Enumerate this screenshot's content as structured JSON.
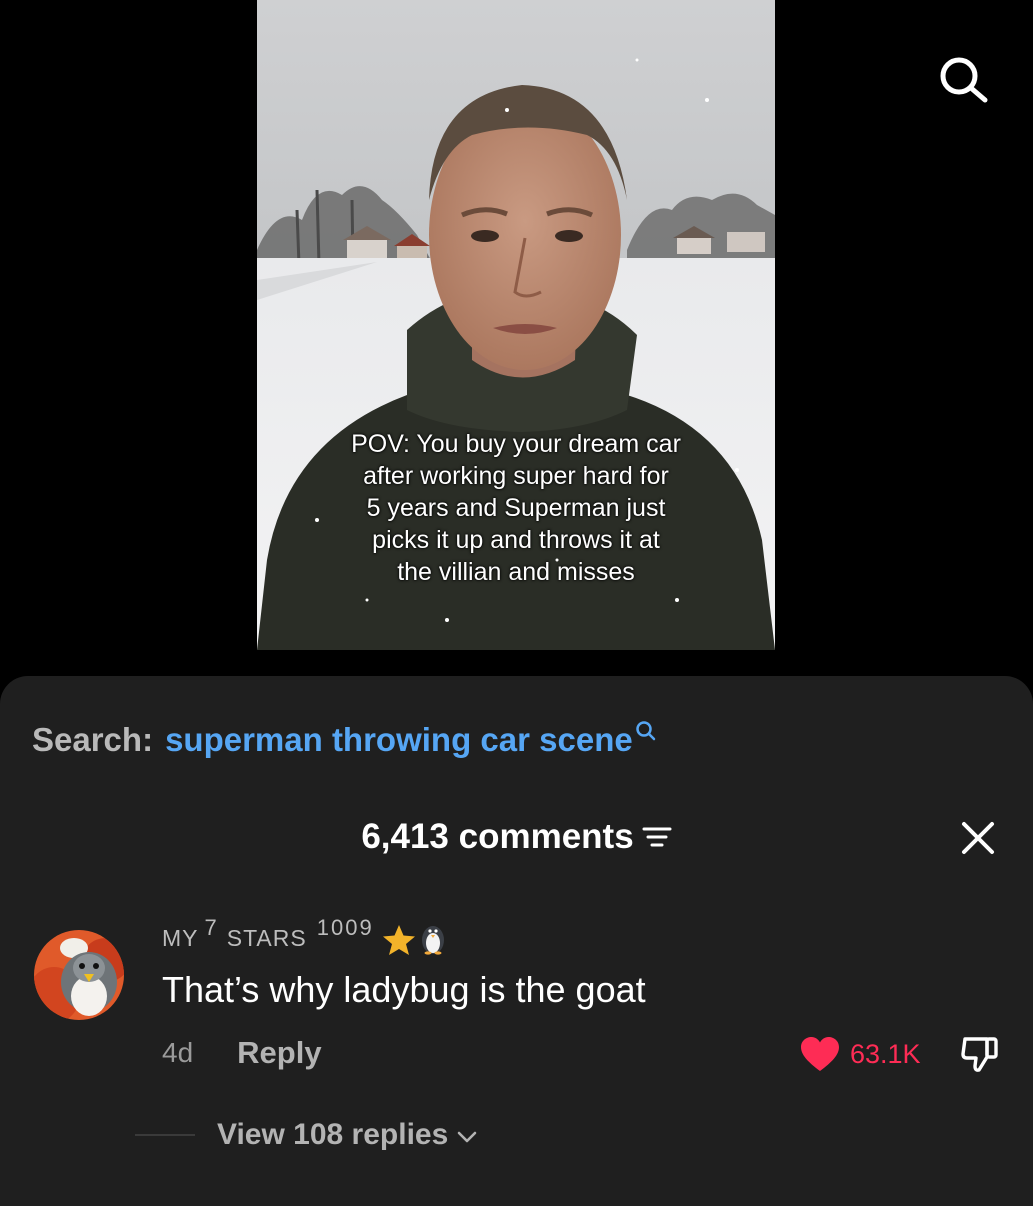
{
  "video": {
    "caption_lines": [
      "POV: You buy your dream car",
      "after working super hard for",
      "5 years and Superman just",
      "picks it up and throws it at",
      "the villian and misses"
    ]
  },
  "icons": {
    "top_search": "search-icon",
    "search_suggestion": "search-icon",
    "filter": "filter-icon",
    "close": "close-icon",
    "like": "heart-icon",
    "dislike": "thumbs-down-icon",
    "expand": "chevron-down-icon",
    "badge_1": "star-icon",
    "badge_2": "penguin-icon"
  },
  "search": {
    "prefix": "Search:",
    "term": "superman throwing car scene"
  },
  "comments_header": {
    "count_label": "6,413 comments"
  },
  "comment": {
    "username_part1": "MY",
    "username_sup1": "7",
    "username_part2": "STARS",
    "username_sup2": "1009",
    "text": "That’s why ladybug is the goat",
    "time": "4d",
    "reply_label": "Reply",
    "like_count": "63.1K",
    "view_replies_label": "View 108 replies"
  },
  "colors": {
    "background": "#000000",
    "sheet": "#1f1f1f",
    "search_term": "#56a6f4",
    "like": "#fe2c55"
  }
}
